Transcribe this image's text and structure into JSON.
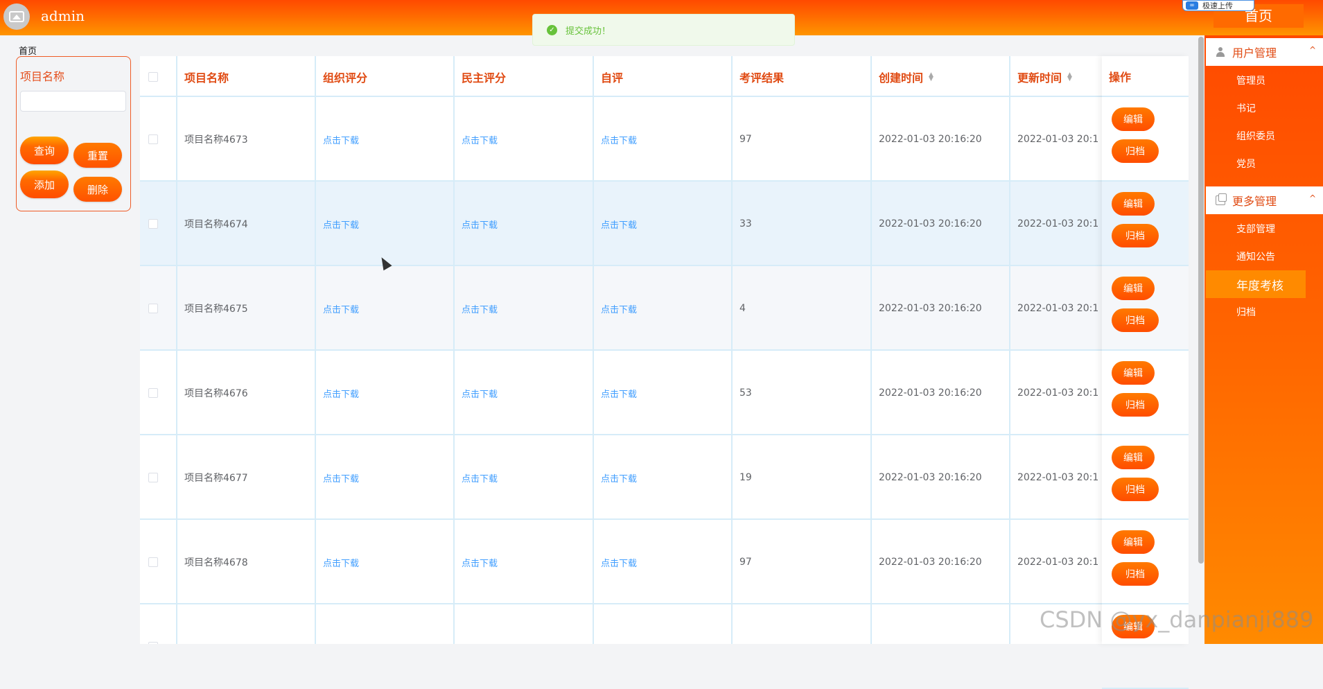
{
  "header": {
    "user": "admin",
    "home": "首页",
    "upload_label": "极速上传"
  },
  "toast": {
    "message": "提交成功！"
  },
  "breadcrumb": "首页",
  "search": {
    "label": "项目名称",
    "placeholder": "",
    "query": "查询",
    "reset": "重置",
    "add": "添加",
    "delete": "删除"
  },
  "table": {
    "columns": [
      "项目名称",
      "组织评分",
      "民主评分",
      "自评",
      "考评结果",
      "创建时间",
      "更新时间",
      "操作"
    ],
    "rows": [
      {
        "name": "项目名称4673",
        "org": "点击下载",
        "demo": "点击下载",
        "self": "点击下载",
        "result": "97",
        "created": "2022-01-03 20:16:20",
        "updated": "2022-01-03 20:1"
      },
      {
        "name": "项目名称4674",
        "org": "点击下载",
        "demo": "点击下载",
        "self": "点击下载",
        "result": "33",
        "created": "2022-01-03 20:16:20",
        "updated": "2022-01-03 20:1"
      },
      {
        "name": "项目名称4675",
        "org": "点击下载",
        "demo": "点击下载",
        "self": "点击下载",
        "result": "4",
        "created": "2022-01-03 20:16:20",
        "updated": "2022-01-03 20:1"
      },
      {
        "name": "项目名称4676",
        "org": "点击下载",
        "demo": "点击下载",
        "self": "点击下载",
        "result": "53",
        "created": "2022-01-03 20:16:20",
        "updated": "2022-01-03 20:1"
      },
      {
        "name": "项目名称4677",
        "org": "点击下载",
        "demo": "点击下载",
        "self": "点击下载",
        "result": "19",
        "created": "2022-01-03 20:16:20",
        "updated": "2022-01-03 20:1"
      },
      {
        "name": "项目名称4678",
        "org": "点击下载",
        "demo": "点击下载",
        "self": "点击下载",
        "result": "97",
        "created": "2022-01-03 20:16:20",
        "updated": "2022-01-03 20:1"
      },
      {
        "name": "",
        "org": "",
        "demo": "",
        "self": "",
        "result": "",
        "created": "",
        "updated": ""
      }
    ],
    "edit": "编辑",
    "archive": "归档"
  },
  "sidebar": {
    "groups": [
      {
        "label": "用户管理",
        "items": [
          "管理员",
          "书记",
          "组织委员",
          "党员"
        ]
      },
      {
        "label": "更多管理",
        "items": [
          "支部管理",
          "通知公告",
          "年度考核",
          "归档"
        ]
      }
    ]
  },
  "watermark": "CSDN @yx_danpianji889",
  "colors": {
    "accent": "#ff6a00",
    "header_text": "#e04a12",
    "link": "#409eff",
    "success": "#67c23a"
  }
}
